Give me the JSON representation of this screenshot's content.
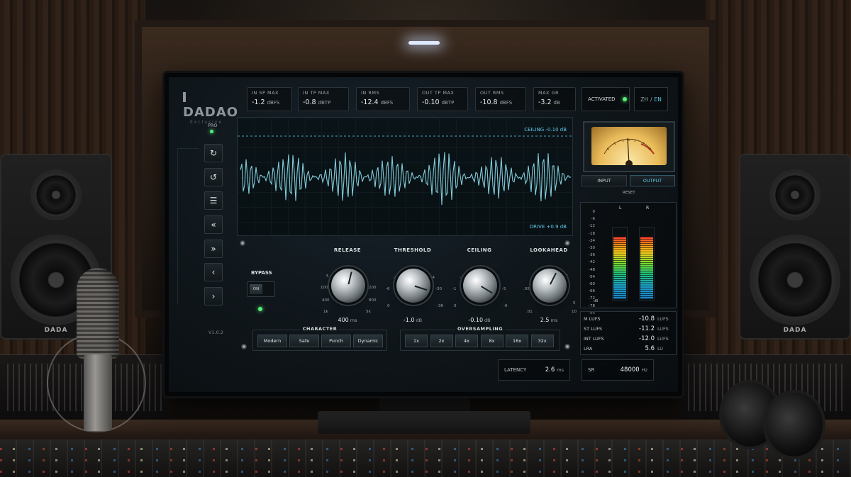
{
  "brand": {
    "logo": "DADAO",
    "sub": "Exclusive"
  },
  "meters_top": [
    {
      "label": "IN SP MAX",
      "value": "-1.2",
      "unit": "dBFS"
    },
    {
      "label": "IN TP MAX",
      "value": "-0.8",
      "unit": "dBTP"
    },
    {
      "label": "IN RMS",
      "value": "-12.4",
      "unit": "dBFS"
    },
    {
      "label": "OUT TP MAX",
      "value": "-0.10",
      "unit": "dBTP"
    },
    {
      "label": "OUT RMS",
      "value": "-10.8",
      "unit": "dBFS"
    },
    {
      "label": "MAX GR",
      "value": "-3.2",
      "unit": "dB"
    }
  ],
  "status": {
    "activated_label": "ACTIVATED",
    "lang_zh": "ZH",
    "lang_sep": "/",
    "lang_en": "EN",
    "led_color": "#57f07a",
    "accent": "#5ec7e6"
  },
  "nav": {
    "pro_label": "PRO",
    "version": "V1.0.2",
    "buttons": [
      {
        "icon": "redo-icon",
        "glyph": "↻"
      },
      {
        "icon": "undo-icon",
        "glyph": "↺"
      },
      {
        "icon": "list-icon",
        "glyph": "☰"
      },
      {
        "icon": "rewind-icon",
        "glyph": "«"
      },
      {
        "icon": "fast-forward-icon",
        "glyph": "»"
      },
      {
        "icon": "chevron-left-icon",
        "glyph": "‹"
      },
      {
        "icon": "chevron-right-icon",
        "glyph": "›"
      }
    ]
  },
  "waveform": {
    "ceiling_label": "CEILING -0.10 dB",
    "drive_label": "DRIVE +0.9 dB"
  },
  "bypass": {
    "label": "BYPASS",
    "switch_text": "ON"
  },
  "knobs": [
    {
      "title": "RELEASE",
      "value": "400",
      "unit": "ms",
      "ticks": [
        "1",
        "5",
        "20",
        "100",
        "200",
        "400",
        "800",
        "1k",
        "5k"
      ],
      "amount": 0.55
    },
    {
      "title": "THRESHOLD",
      "value": "-1.0",
      "unit": "dB",
      "ticks": [
        "-18",
        "-12",
        "-24",
        "-6",
        "-30",
        "0",
        "-36"
      ],
      "amount": 0.9
    },
    {
      "title": "CEILING",
      "value": "-0.10",
      "unit": "dB",
      "ticks": [
        "-3",
        "-2",
        "-4",
        "-1",
        "-5",
        "0",
        "-6"
      ],
      "amount": 0.95
    },
    {
      "title": "LOOKAHEAD",
      "value": "2.5",
      "unit": "ms",
      "ticks": [
        "1",
        "1",
        ".05",
        "5",
        ".01",
        "10"
      ],
      "amount": 0.6
    }
  ],
  "character": {
    "title": "CHARACTER",
    "options": [
      "Modern",
      "Safe",
      "Punch",
      "Dynamic"
    ]
  },
  "oversampling": {
    "title": "OVERSAMPLING",
    "options": [
      "1x",
      "2x",
      "4x",
      "8x",
      "16x",
      "32x"
    ]
  },
  "latency": {
    "label": "LATENCY",
    "value": "2.6",
    "unit": "ms"
  },
  "samplerate": {
    "label": "SR",
    "value": "48000",
    "unit": "Hz"
  },
  "io": {
    "input": "INPUT",
    "output": "OUTPUT",
    "reset": "RESET"
  },
  "level_meters": {
    "scale": [
      "0",
      "-6",
      "-12",
      "-18",
      "-24",
      "-30",
      "-36",
      "-42",
      "-48",
      "-54",
      "-60",
      "-66",
      "-72",
      "-78",
      "-86"
    ],
    "db_label": "dB",
    "left": {
      "label": "L",
      "level": 0.86
    },
    "right": {
      "label": "R",
      "level": 0.86
    }
  },
  "loudness": [
    {
      "label": "M LUFS",
      "value": "-10.8",
      "unit": "LUFS"
    },
    {
      "label": "ST LUFS",
      "value": "-11.2",
      "unit": "LUFS"
    },
    {
      "label": "INT LUFS",
      "value": "-12.0",
      "unit": "LUFS"
    },
    {
      "label": "LRA",
      "value": "5.6",
      "unit": "LU"
    }
  ],
  "speaker_logo": "DADA"
}
